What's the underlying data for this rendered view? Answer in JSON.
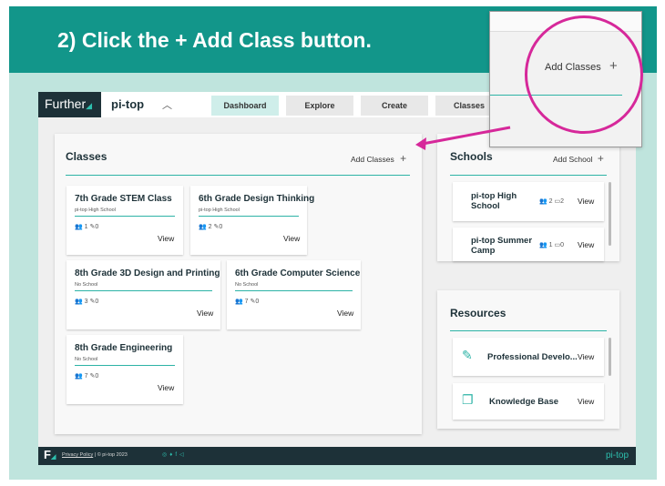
{
  "instruction": "2) Click  the + Add Class button.",
  "nav": {
    "logo": "Further",
    "school": "pi-top",
    "tabs": [
      "Dashboard",
      "Explore",
      "Create",
      "Classes"
    ]
  },
  "classes_panel": {
    "title": "Classes",
    "action": "Add Classes",
    "cards": [
      {
        "title": "7th Grade STEM Class",
        "school": "pi-top High School",
        "students": "1",
        "edits": "0",
        "view": "View"
      },
      {
        "title": "6th Grade Design Thinking",
        "school": "pi-top High School",
        "students": "2",
        "edits": "0",
        "view": "View"
      },
      {
        "title": "8th Grade 3D Design and Printing",
        "school": "No School",
        "students": "3",
        "edits": "0",
        "view": "View"
      },
      {
        "title": "6th Grade Computer Science",
        "school": "No School",
        "students": "7",
        "edits": "0",
        "view": "View"
      },
      {
        "title": "8th Grade Engineering",
        "school": "No School",
        "students": "7",
        "edits": "0",
        "view": "View"
      }
    ]
  },
  "schools_panel": {
    "title": "Schools",
    "action": "Add School",
    "items": [
      {
        "name": "pi-top High School",
        "students": "2",
        "classes": "2",
        "view": "View"
      },
      {
        "name": "pi-top Summer Camp",
        "students": "1",
        "classes": "0",
        "view": "View"
      }
    ]
  },
  "resources_panel": {
    "title": "Resources",
    "items": [
      {
        "name": "Professional Develo...",
        "view": "View"
      },
      {
        "name": "Knowledge Base",
        "view": "View"
      }
    ]
  },
  "footer": {
    "logo": "F",
    "privacy": "Privacy Policy",
    "copyright": "| © pi-top 2023",
    "brand": "pi-top"
  },
  "zoom_label": "Add Classes",
  "colors": {
    "teal": "#12968a",
    "accent": "#2db3a6",
    "highlight": "#d6289a",
    "dark": "#1d3138"
  }
}
